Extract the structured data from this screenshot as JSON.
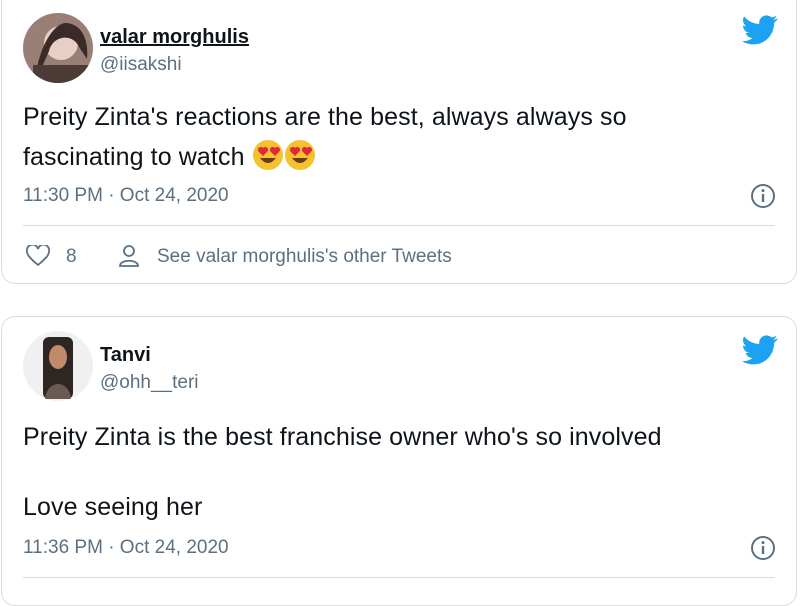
{
  "tweets": [
    {
      "display_name": "valar morghulis",
      "handle": "@iisakshi",
      "text_lines": [
        "Preity Zinta's reactions are the best, always always so",
        "fascinating to watch"
      ],
      "emojis": [
        "heart-eyes-emoji",
        "heart-eyes-emoji"
      ],
      "timestamp": "11:30 PM · Oct 24, 2020",
      "like_count": "8",
      "other_tweets_label": "See valar morghulis's other Tweets"
    },
    {
      "display_name": "Tanvi",
      "handle": "@ohh__teri",
      "text_lines": [
        "Preity Zinta is the best franchise owner who's so involved",
        "",
        "Love seeing her"
      ],
      "timestamp": "11:36 PM · Oct 24, 2020"
    }
  ],
  "icons": {
    "brand": "twitter-bird-icon",
    "info": "info-icon",
    "like": "heart-icon",
    "profile": "person-icon"
  },
  "colors": {
    "twitter_blue": "#1da1f2",
    "secondary_text": "#5b7083",
    "border": "#d3dde5"
  }
}
